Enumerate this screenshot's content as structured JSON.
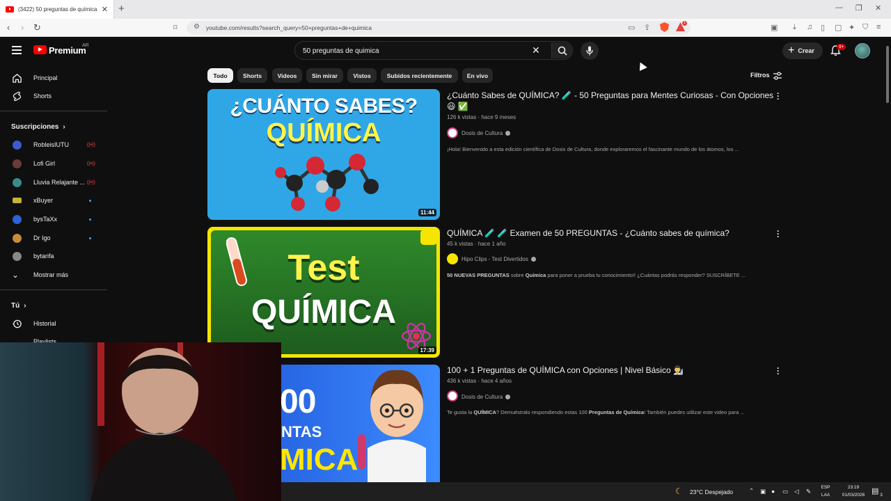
{
  "browser": {
    "tab_title": "(3422) 50 preguntas de química",
    "tab_close": "✕",
    "new_tab": "+",
    "url": "youtube.com/results?search_query=50+preguntas+de+quimica",
    "window_controls": [
      "—",
      "❐",
      "✕"
    ],
    "brave_shield_badge": "",
    "rewards_badge": "1"
  },
  "masthead": {
    "logo_text": "Premium",
    "region": "AR",
    "search_value": "50 preguntas de quimica",
    "create_label": "Crear",
    "notifications_badge": "9+"
  },
  "sidebar": {
    "main": [
      {
        "label": "Principal",
        "icon": "home-icon"
      },
      {
        "label": "Shorts",
        "icon": "shorts-icon"
      }
    ],
    "subscriptions_header": "Suscripciones",
    "subscriptions": [
      {
        "name": "RobleisIUTU",
        "status": "live",
        "color": "#3b5bd0"
      },
      {
        "name": "Lofi Girl",
        "status": "live",
        "color": "#6d3a3a"
      },
      {
        "name": "Lluvia Relajante ...",
        "status": "live",
        "color": "#3b8a8a"
      },
      {
        "name": "xBuyer",
        "status": "new",
        "color": "#c9b234"
      },
      {
        "name": "bysTaXx",
        "status": "new",
        "color": "#2c63d6"
      },
      {
        "name": "Dr Igo",
        "status": "new",
        "color": "#c78b3a"
      },
      {
        "name": "bytarifa",
        "status": "none",
        "color": "#888888"
      }
    ],
    "show_more": "Mostrar más",
    "you_header": "Tú",
    "you_items": [
      {
        "label": "Historial",
        "icon": "history-icon"
      },
      {
        "label": "Playlists",
        "icon": "playlists-icon"
      }
    ]
  },
  "chips": [
    {
      "label": "Todo",
      "active": true
    },
    {
      "label": "Shorts"
    },
    {
      "label": "Videos"
    },
    {
      "label": "Sin mirar"
    },
    {
      "label": "Vistos"
    },
    {
      "label": "Subidos recientemente"
    },
    {
      "label": "En vivo"
    }
  ],
  "filters_label": "Filtros",
  "results": [
    {
      "title": "¿Cuánto Sabes de QUÍMICA? 🧪 - 50 Preguntas para Mentes Curiosas - Con Opciones 😃 ✅",
      "views": "126 k vistas",
      "age": "hace 9 meses",
      "channel": "Dosis de Cultura",
      "description": "¡Hola! Bienvenido a esta edición científica de Dosis de Cultura, donde exploraremos el fascinante mundo de los átomos, los ...",
      "duration": "11:44",
      "thumb_line1": "¿CUÁNTO SABES?",
      "thumb_line2": "QUÍMICA"
    },
    {
      "title": "QUÍMICA 🧪 🧪 Examen de 50 PREGUNTAS - ¿Cuánto sabes de química?",
      "views": "45 k vistas",
      "age": "hace 1 año",
      "channel": "Hipo Clips - Test Divertidos",
      "description_parts": [
        "50 NUEVAS ",
        "PREGUNTAS",
        " sobre ",
        "Química",
        " para poner a prueba tu conocimiento!! ¿Cuántas podrás responder? SUSCRÍBETE ..."
      ],
      "duration": "17:39",
      "thumb_line1": "Test",
      "thumb_line2": "QUÍMICA"
    },
    {
      "title": "100 + 1 Preguntas de QUÍMICA con Opciones | Nivel Básico 👨‍🔬",
      "views": "436 k vistas",
      "age": "hace 4 años",
      "channel": "Dosis de Cultura",
      "description_parts": [
        "Te gusta la ",
        "QUÍMICA",
        "? Demuéstralo respondiendo estas 100 ",
        "Preguntas de Química",
        "! También puedes utilizar este video para ..."
      ],
      "thumb_line1": "00",
      "thumb_line2": "NTAS",
      "thumb_line3": "MICA"
    }
  ],
  "taskbar": {
    "weather": "23°C  Despejado",
    "lang1": "ESP",
    "lang2": "LAA",
    "time": "23:19",
    "date": "01/03/2026",
    "notif_count": "3"
  },
  "colors": {
    "yt_red": "#ff0000",
    "chip_bg": "#272727",
    "bg": "#0f0f0f"
  }
}
